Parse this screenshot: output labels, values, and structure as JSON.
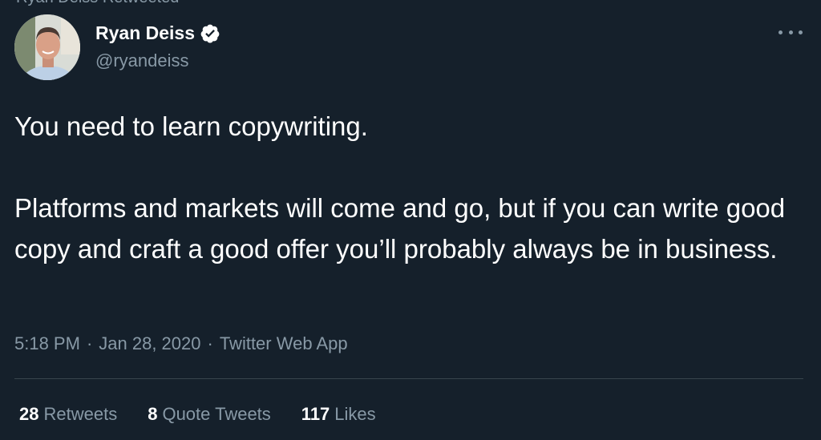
{
  "header": {
    "top_partial_text": "Ryan Deiss Retweeted",
    "author_name": "Ryan Deiss",
    "author_handle": "@ryandeiss",
    "verified": true
  },
  "tweet": {
    "paragraphs": [
      "You need to learn copywriting.",
      "Platforms and markets will come and go, but if you can write good copy and craft a good offer you’ll probably always be in business."
    ],
    "time": "5:18 PM",
    "date": "Jan 28, 2020",
    "source": "Twitter Web App",
    "separator": "·"
  },
  "stats": {
    "retweets_count": "28",
    "retweets_label": "Retweets",
    "quotes_count": "8",
    "quotes_label": "Quote Tweets",
    "likes_count": "117",
    "likes_label": "Likes"
  },
  "colors": {
    "background": "#15202b",
    "primary_text": "#ffffff",
    "secondary_text": "#8899a6",
    "divider": "#38444d"
  },
  "icons": [
    "verified-badge-icon",
    "more-options-icon"
  ]
}
